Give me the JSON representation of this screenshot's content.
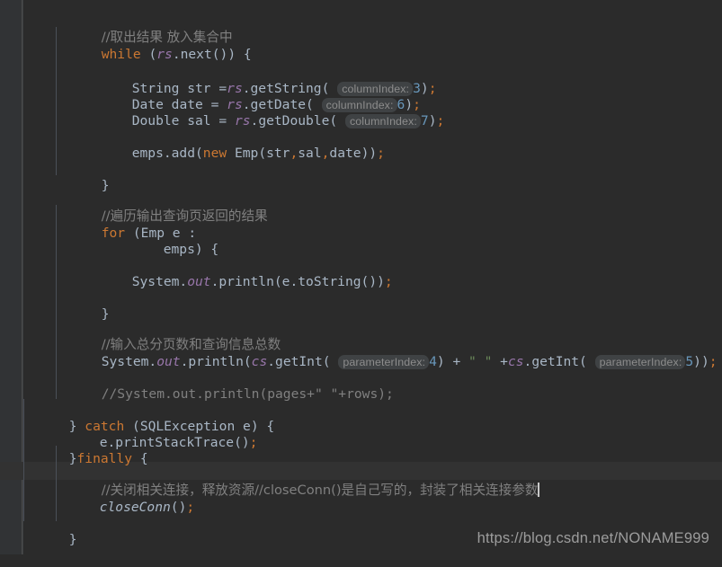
{
  "editor": {
    "theme": "darcula",
    "background_color": "#2b2b2b",
    "gutter_color": "#313335",
    "current_line_color": "#323232",
    "colors": {
      "default_text": "#a9b7c6",
      "keyword": "#cc7832",
      "number": "#6897bb",
      "string": "#6a8759",
      "comment": "#808080",
      "field": "#9876aa",
      "hint_background": "#3f4244",
      "hint_text": "#8c8c8c",
      "caret": "#c8c8c8",
      "indent_guide": "#4b5059"
    }
  },
  "code_lines": [
    {
      "id": "l1",
      "text": "//取出结果 放入集合中"
    },
    {
      "id": "l2",
      "text": "while (rs.next()) {"
    },
    {
      "id": "l3",
      "text": ""
    },
    {
      "id": "l4",
      "text": "String str =rs.getString( columnIndex: 3);"
    },
    {
      "id": "l5",
      "text": "Date date = rs.getDate( columnIndex: 6);"
    },
    {
      "id": "l6",
      "text": "Double sal = rs.getDouble( columnIndex: 7);"
    },
    {
      "id": "l7",
      "text": ""
    },
    {
      "id": "l8",
      "text": "emps.add(new Emp(str,sal,date));"
    },
    {
      "id": "l9",
      "text": ""
    },
    {
      "id": "l10",
      "text": "}"
    },
    {
      "id": "l11",
      "text": ""
    },
    {
      "id": "l12",
      "text": "//遍历输出查询页返回的结果"
    },
    {
      "id": "l13",
      "text": "for (Emp e :"
    },
    {
      "id": "l14",
      "text": "     emps) {"
    },
    {
      "id": "l15",
      "text": ""
    },
    {
      "id": "l16",
      "text": "System.out.println(e.toString());"
    },
    {
      "id": "l17",
      "text": ""
    },
    {
      "id": "l18",
      "text": "}"
    },
    {
      "id": "l19",
      "text": ""
    },
    {
      "id": "l20",
      "text": "//输入总分页数和查询信息总数"
    },
    {
      "id": "l21",
      "text": "System.out.println(cs.getInt( parameterIndex: 4) + \" \" +cs.getInt( parameterIndex: 5));"
    },
    {
      "id": "l22",
      "text": ""
    },
    {
      "id": "l23",
      "text": "//System.out.println(pages+\" \"+rows);"
    },
    {
      "id": "l24",
      "text": ""
    },
    {
      "id": "l25",
      "text": "} catch (SQLException e) {"
    },
    {
      "id": "l26",
      "text": "e.printStackTrace();"
    },
    {
      "id": "l27",
      "text": "}finally {"
    },
    {
      "id": "l28",
      "text": ""
    },
    {
      "id": "l29",
      "text": "//关闭相关连接，释放资源//closeConn()是自己写的，封装了相关连接参数"
    },
    {
      "id": "l30",
      "text": "closeConn();"
    },
    {
      "id": "l31",
      "text": ""
    },
    {
      "id": "l32",
      "text": "}"
    }
  ],
  "tokens": {
    "kw_while": "while",
    "kw_for": "for",
    "kw_new": "new",
    "kw_catch": "catch",
    "kw_finally": "finally",
    "type_string": "String",
    "type_date": "Date",
    "type_double": "Double",
    "type_emp": "Emp",
    "type_sqlexception": "SQLException",
    "field_rs": "rs",
    "field_cs": "cs",
    "field_out": "out",
    "hint_columnindex": "columnIndex:",
    "hint_parameterindex": "parameterIndex:",
    "num_3": "3",
    "num_6": "6",
    "num_7": "7",
    "num_4": "4",
    "num_5": "5",
    "str_space": "\" \"",
    "method_closeconn": "closeConn"
  },
  "watermark": {
    "text": "https://blog.csdn.net/NONAME999"
  }
}
